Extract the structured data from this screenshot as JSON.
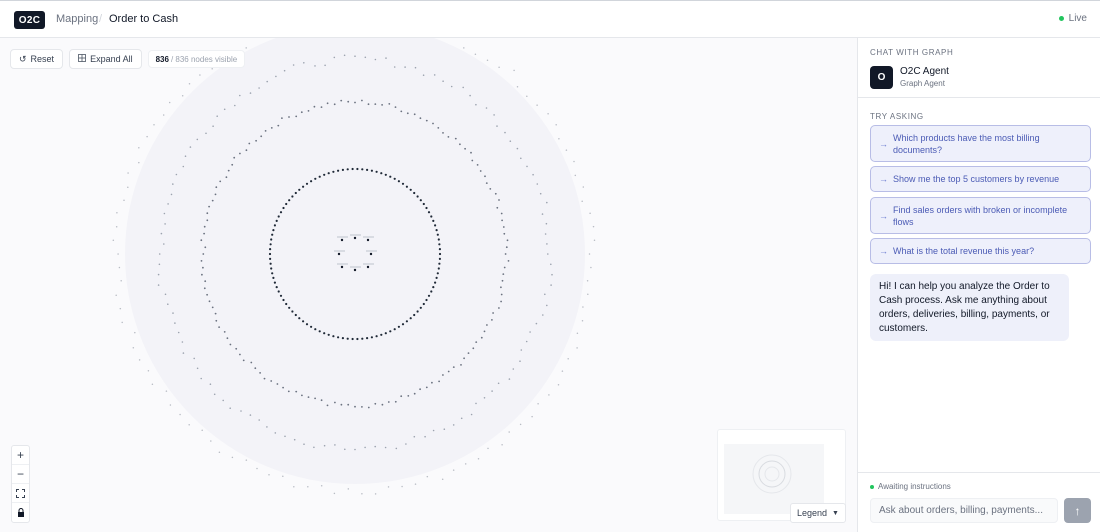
{
  "header": {
    "logo": "O2C",
    "breadcrumb_parent": "Mapping",
    "breadcrumb_separator": "/",
    "breadcrumb_current": "Order to Cash",
    "status_label": "Live"
  },
  "graph": {
    "reset_label": "Reset",
    "expand_label": "Expand All",
    "visible_count": "836",
    "total_nodes_text": "/ 836 nodes visible",
    "legend_label": "Legend",
    "zoom_in": "+",
    "zoom_out": "−"
  },
  "sidebar": {
    "chat_title": "CHAT WITH GRAPH",
    "agent_avatar": "O",
    "agent_name": "O2C Agent",
    "agent_role": "Graph Agent",
    "try_title": "TRY ASKING",
    "suggestions": [
      "Which products have the most billing documents?",
      "Show me the top 5 customers by revenue",
      "Find sales orders with broken or incomplete flows",
      "What is the total revenue this year?"
    ],
    "greeting": "Hi! I can help you analyze the Order to Cash process. Ask me anything about orders, deliveries, billing, payments, or customers.",
    "status_text": "Awaiting instructions",
    "input_placeholder": "Ask about orders, billing, payments...",
    "send_icon": "arrow-up-icon"
  },
  "colors": {
    "brand_dark": "#111827",
    "live_green": "#22c55e",
    "suggestion_bg": "#eef0fb",
    "suggestion_text": "#4b5bb5"
  }
}
